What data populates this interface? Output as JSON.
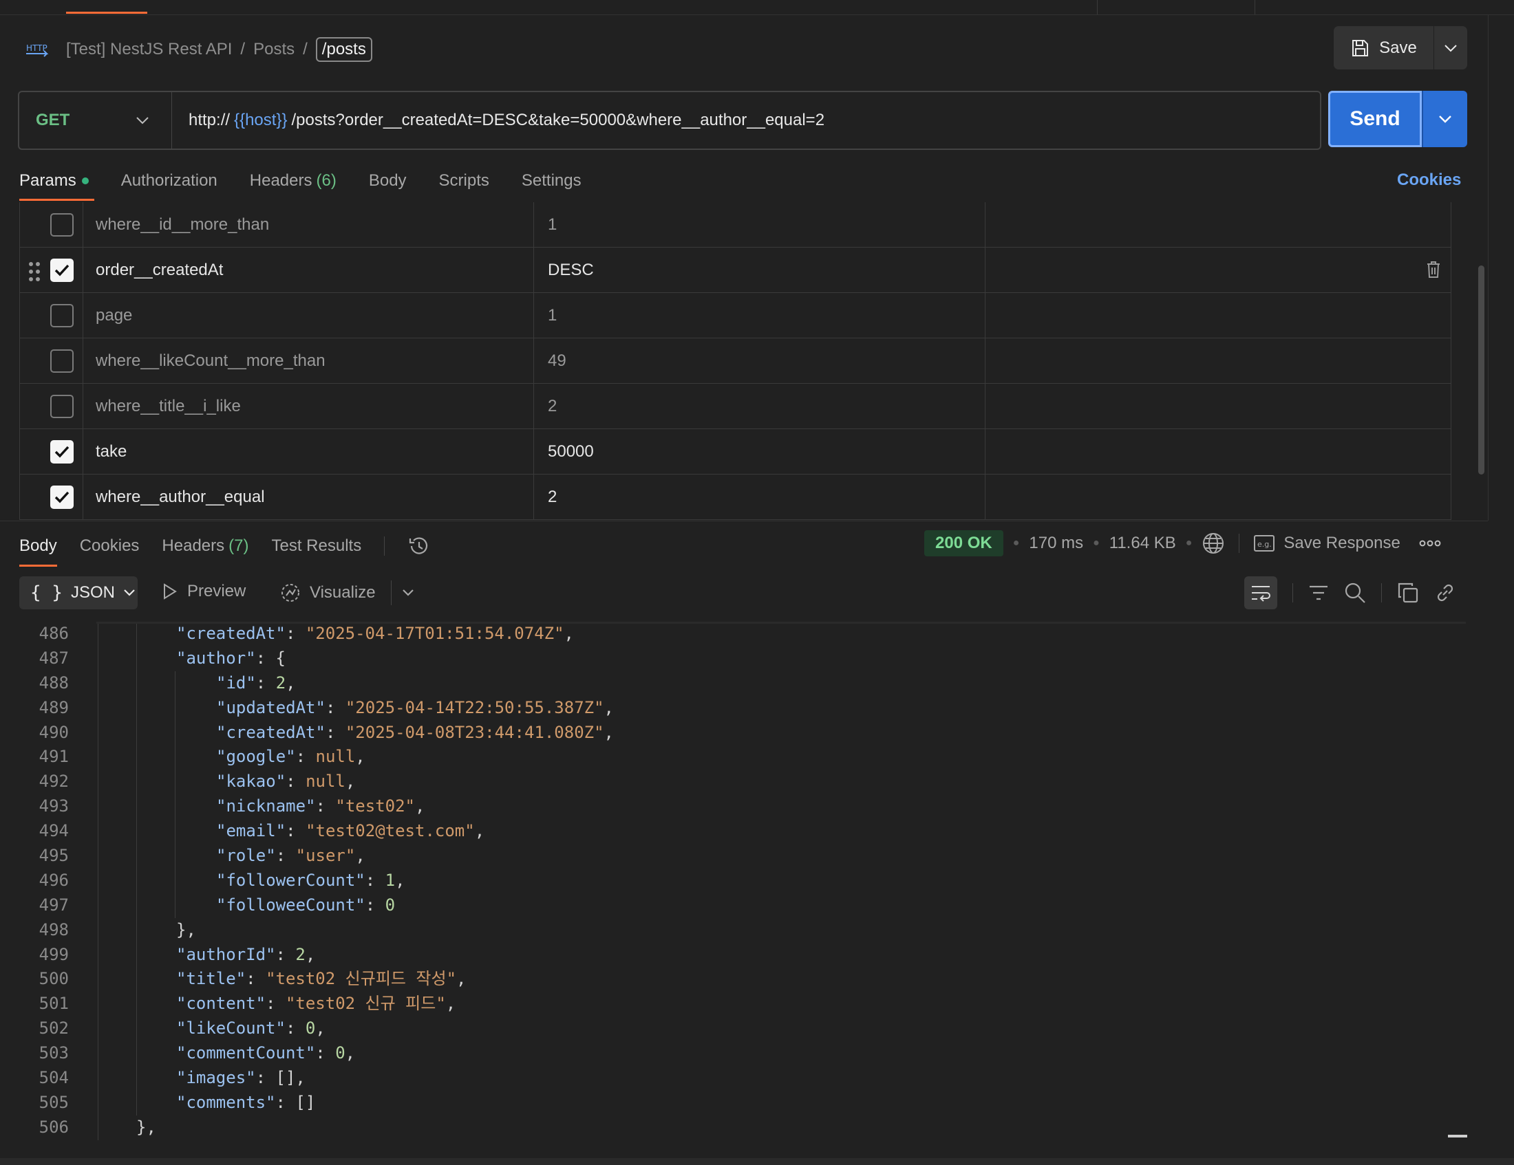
{
  "header": {
    "breadcrumb": [
      "[Test] NestJS Rest API",
      "Posts",
      "/posts"
    ],
    "breadcrumb_sep": "/",
    "save_label": "Save"
  },
  "request": {
    "method": "GET",
    "url_prefix": "http://",
    "url_var": "{{host}}",
    "url_rest": "/posts?order__createdAt=DESC&take=50000&where__author__equal=2",
    "send_label": "Send",
    "tabs": [
      {
        "label": "Params",
        "active": true
      },
      {
        "label": "Authorization"
      },
      {
        "label": "Headers",
        "count": "(6)"
      },
      {
        "label": "Body"
      },
      {
        "label": "Scripts"
      },
      {
        "label": "Settings"
      }
    ],
    "cookies_label": "Cookies"
  },
  "params": [
    {
      "key": "where__id__more_than",
      "value": "1",
      "checked": false
    },
    {
      "key": "order__createdAt",
      "value": "DESC",
      "checked": true,
      "hovered": true
    },
    {
      "key": "page",
      "value": "1",
      "checked": false
    },
    {
      "key": "where__likeCount__more_than",
      "value": "49",
      "checked": false
    },
    {
      "key": "where__title__i_like",
      "value": "2",
      "checked": false
    },
    {
      "key": "take",
      "value": "50000",
      "checked": true
    },
    {
      "key": "where__author__equal",
      "value": "2",
      "checked": true
    }
  ],
  "response": {
    "tabs": [
      {
        "label": "Body",
        "active": true
      },
      {
        "label": "Cookies"
      },
      {
        "label": "Headers",
        "count": "(7)"
      },
      {
        "label": "Test Results"
      }
    ],
    "status": "200 OK",
    "time": "170 ms",
    "size": "11.64 KB",
    "save_response_label": "Save Response",
    "format_label": "JSON",
    "preview_label": "Preview",
    "visualize_label": "Visualize"
  },
  "code_lines": [
    {
      "n": "486",
      "i": 2,
      "t": [
        [
          "k",
          "\"createdAt\""
        ],
        [
          "p",
          ": "
        ],
        [
          "s",
          "\"2025-04-17T01:51:54.074Z\""
        ],
        [
          "p",
          ","
        ]
      ]
    },
    {
      "n": "487",
      "i": 2,
      "t": [
        [
          "k",
          "\"author\""
        ],
        [
          "p",
          ": {"
        ]
      ]
    },
    {
      "n": "488",
      "i": 3,
      "t": [
        [
          "k",
          "\"id\""
        ],
        [
          "p",
          ": "
        ],
        [
          "n",
          "2"
        ],
        [
          "p",
          ","
        ]
      ]
    },
    {
      "n": "489",
      "i": 3,
      "t": [
        [
          "k",
          "\"updatedAt\""
        ],
        [
          "p",
          ": "
        ],
        [
          "s",
          "\"2025-04-14T22:50:55.387Z\""
        ],
        [
          "p",
          ","
        ]
      ]
    },
    {
      "n": "490",
      "i": 3,
      "t": [
        [
          "k",
          "\"createdAt\""
        ],
        [
          "p",
          ": "
        ],
        [
          "s",
          "\"2025-04-08T23:44:41.080Z\""
        ],
        [
          "p",
          ","
        ]
      ]
    },
    {
      "n": "491",
      "i": 3,
      "t": [
        [
          "k",
          "\"google\""
        ],
        [
          "p",
          ": "
        ],
        [
          "nl",
          "null"
        ],
        [
          "p",
          ","
        ]
      ]
    },
    {
      "n": "492",
      "i": 3,
      "t": [
        [
          "k",
          "\"kakao\""
        ],
        [
          "p",
          ": "
        ],
        [
          "nl",
          "null"
        ],
        [
          "p",
          ","
        ]
      ]
    },
    {
      "n": "493",
      "i": 3,
      "t": [
        [
          "k",
          "\"nickname\""
        ],
        [
          "p",
          ": "
        ],
        [
          "s",
          "\"test02\""
        ],
        [
          "p",
          ","
        ]
      ]
    },
    {
      "n": "494",
      "i": 3,
      "t": [
        [
          "k",
          "\"email\""
        ],
        [
          "p",
          ": "
        ],
        [
          "s",
          "\"test02@test.com\""
        ],
        [
          "p",
          ","
        ]
      ]
    },
    {
      "n": "495",
      "i": 3,
      "t": [
        [
          "k",
          "\"role\""
        ],
        [
          "p",
          ": "
        ],
        [
          "s",
          "\"user\""
        ],
        [
          "p",
          ","
        ]
      ]
    },
    {
      "n": "496",
      "i": 3,
      "t": [
        [
          "k",
          "\"followerCount\""
        ],
        [
          "p",
          ": "
        ],
        [
          "n",
          "1"
        ],
        [
          "p",
          ","
        ]
      ]
    },
    {
      "n": "497",
      "i": 3,
      "t": [
        [
          "k",
          "\"followeeCount\""
        ],
        [
          "p",
          ": "
        ],
        [
          "n",
          "0"
        ]
      ]
    },
    {
      "n": "498",
      "i": 2,
      "t": [
        [
          "p",
          "},"
        ]
      ]
    },
    {
      "n": "499",
      "i": 2,
      "t": [
        [
          "k",
          "\"authorId\""
        ],
        [
          "p",
          ": "
        ],
        [
          "n",
          "2"
        ],
        [
          "p",
          ","
        ]
      ]
    },
    {
      "n": "500",
      "i": 2,
      "t": [
        [
          "k",
          "\"title\""
        ],
        [
          "p",
          ": "
        ],
        [
          "s",
          "\"test02 신규피드 작성\""
        ],
        [
          "p",
          ","
        ]
      ]
    },
    {
      "n": "501",
      "i": 2,
      "t": [
        [
          "k",
          "\"content\""
        ],
        [
          "p",
          ": "
        ],
        [
          "s",
          "\"test02 신규 피드\""
        ],
        [
          "p",
          ","
        ]
      ]
    },
    {
      "n": "502",
      "i": 2,
      "t": [
        [
          "k",
          "\"likeCount\""
        ],
        [
          "p",
          ": "
        ],
        [
          "n",
          "0"
        ],
        [
          "p",
          ","
        ]
      ]
    },
    {
      "n": "503",
      "i": 2,
      "t": [
        [
          "k",
          "\"commentCount\""
        ],
        [
          "p",
          ": "
        ],
        [
          "n",
          "0"
        ],
        [
          "p",
          ","
        ]
      ]
    },
    {
      "n": "504",
      "i": 2,
      "t": [
        [
          "k",
          "\"images\""
        ],
        [
          "p",
          ": [],"
        ]
      ]
    },
    {
      "n": "505",
      "i": 2,
      "t": [
        [
          "k",
          "\"comments\""
        ],
        [
          "p",
          ": []"
        ]
      ]
    },
    {
      "n": "506",
      "i": 1,
      "t": [
        [
          "p",
          "},"
        ]
      ]
    }
  ],
  "colors": {
    "accent": "#ff6c37",
    "send": "#2b6fd6",
    "method_get": "#6bbf85",
    "status_ok": "#7ddb95",
    "link": "#6aa5f4"
  },
  "icons": [
    "http-icon",
    "save-icon",
    "chevron-down-icon",
    "drag-handle-icon",
    "check-icon",
    "trash-icon",
    "history-icon",
    "globe-icon",
    "example-icon",
    "more-icon",
    "braces-icon",
    "play-icon",
    "visualize-icon",
    "wrap-icon",
    "filter-icon",
    "search-icon",
    "copy-icon",
    "link-icon"
  ]
}
